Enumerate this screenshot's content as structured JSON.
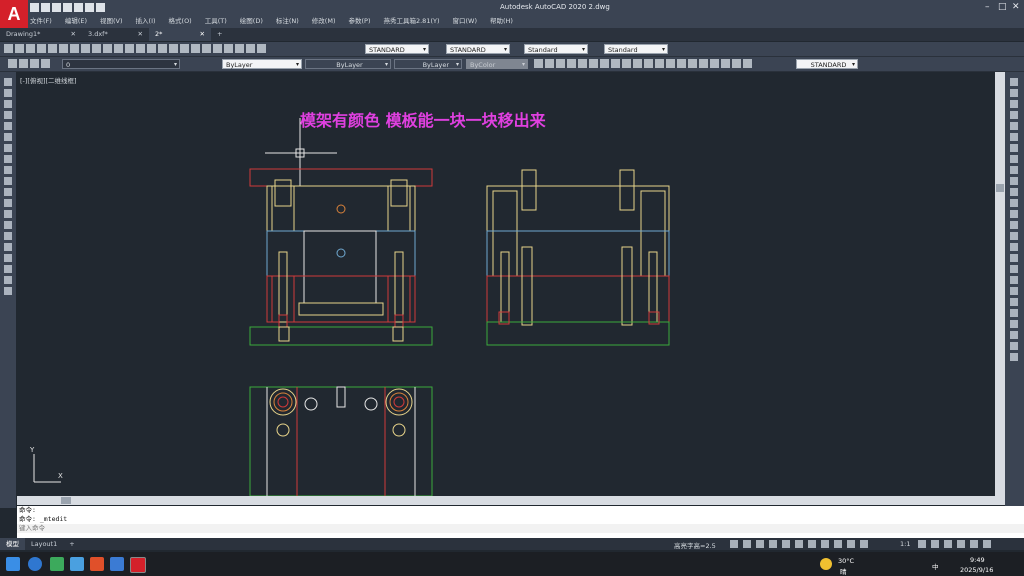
{
  "app": {
    "title": "Autodesk AutoCAD 2020   2.dwg",
    "logo": "A",
    "minimize": "–",
    "maximize": "□",
    "close": "✕"
  },
  "menu": [
    "文件(F)",
    "编辑(E)",
    "视图(V)",
    "插入(I)",
    "格式(O)",
    "工具(T)",
    "绘图(D)",
    "标注(N)",
    "修改(M)",
    "参数(P)",
    "燕秀工具箱2.81(Y)",
    "窗口(W)",
    "帮助(H)"
  ],
  "tabs": [
    {
      "label": "Drawing1*",
      "close": "✕"
    },
    {
      "label": "3.dxf*",
      "close": "✕"
    },
    {
      "label": "2*",
      "close": "✕"
    }
  ],
  "new_tab": "+",
  "toolbar1": {
    "text_style": "STANDARD",
    "dim_style": "STANDARD",
    "table_style": "Standard",
    "mleader_style": "Standard"
  },
  "toolbar2": {
    "layer": "0",
    "color": "ByLayer",
    "linetype": "ByLayer",
    "lineweight": "ByLayer",
    "plotstyle": "ByColor",
    "dim_standard": "STANDARD"
  },
  "viewport_label": "[-][俯视][二维线框]",
  "annotation": {
    "text": "模架有颜色  模板能一块一块移出来",
    "color": "#e040e0"
  },
  "ucs": {
    "x_label": "X",
    "y_label": "Y"
  },
  "command": {
    "line1": "命令:",
    "line2": "命令: _mtedit",
    "prompt": "键入命令"
  },
  "layouts": [
    {
      "label": "模型",
      "active": true
    },
    {
      "label": "Layout1",
      "active": false
    }
  ],
  "add_layout": "+",
  "status": {
    "scale_text": "高亮字高=2.5",
    "annotation_scale": "1:1"
  },
  "taskbar": {
    "temperature": "30°C",
    "weather": "晴",
    "ime": "中",
    "time": "9:49",
    "date": "2025/9/16"
  },
  "colors": {
    "canvas": "#212830",
    "yellow": "#e8d48a",
    "red": "#d03a3a",
    "green": "#3caa3c",
    "cyan": "#6fa8cf",
    "white": "#e6e6e6",
    "orange": "#d9823a"
  }
}
